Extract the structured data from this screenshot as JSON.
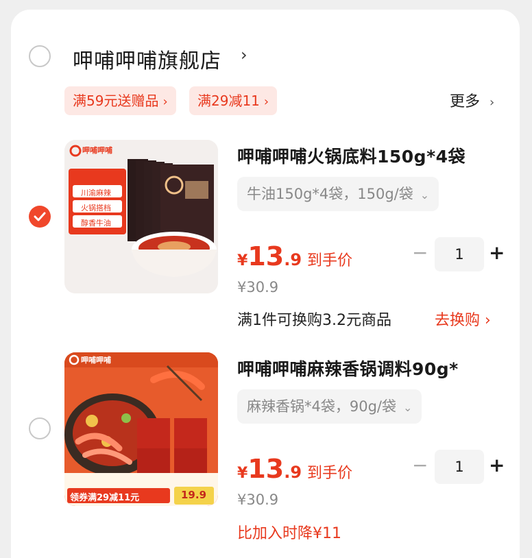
{
  "shop": {
    "name": "呷哺呷哺旗舰店",
    "chevron": "›",
    "selected": false
  },
  "promos": [
    {
      "label": "满59元送赠品",
      "chevron": "›"
    },
    {
      "label": "满29减11",
      "chevron": "›"
    }
  ],
  "more": {
    "label": "更多",
    "chevron": "›"
  },
  "items": [
    {
      "selected": true,
      "brand": "呷哺呷哺",
      "image_tags": [
        "川渝麻辣",
        "火锅搭档",
        "醇香牛油"
      ],
      "title": "呷哺呷哺火锅底料150g*4袋",
      "spec": "牛油150g*4袋，150g/袋",
      "spec_chevron": "⌄",
      "currency": "¥",
      "price_int": "13",
      "price_dec": ".9",
      "price_label": "到手价",
      "orig_price": "¥30.9",
      "qty": "1",
      "minus": "−",
      "plus": "+",
      "note": "满1件可换购3.2元商品",
      "swap_label": "去换购 ›"
    },
    {
      "selected": false,
      "brand": "呷哺呷哺",
      "image_tags": [
        "领券满29减11元",
        "19.9"
      ],
      "title": "呷哺呷哺麻辣香锅调料90g*",
      "spec": "麻辣香锅*4袋，90g/袋",
      "spec_chevron": "⌄",
      "currency": "¥",
      "price_int": "13",
      "price_dec": ".9",
      "price_label": "到手价",
      "orig_price": "¥30.9",
      "qty": "1",
      "minus": "−",
      "plus": "+",
      "drop_note": "比加入时降¥11"
    }
  ],
  "colors": {
    "accent": "#e8391e",
    "promo_bg": "#fde8e4",
    "checked": "#f0472b"
  }
}
